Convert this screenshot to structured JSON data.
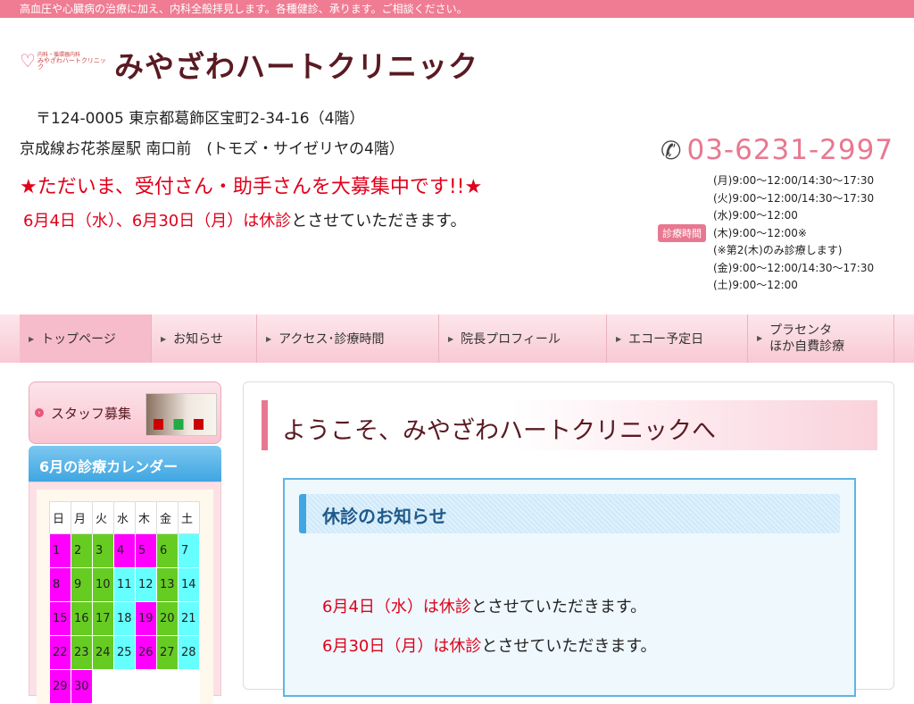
{
  "topbar": {
    "text": "高血圧や心臓病の治療に加え、内科全般拝見します。各種健診、承ります。ご相談ください。"
  },
  "header": {
    "logo_small": "内科・循環器内科",
    "logo_text": "みやざわハートクリニック",
    "site_name": "みやざわハートクリニック",
    "address": "〒124-0005 東京都葛飾区宝町2-34-16（4階）",
    "access": "京成線お花茶屋駅 南口前　(トモズ・サイゼリヤの4階）",
    "recruit": "★ただいま、受付さん・助手さんを大募集中です!!★",
    "closed_red": "6月4日（水）、6月30日（月）は休診",
    "closed_rest": "とさせていただきます。",
    "phone": "03-6231-2997",
    "hours_badge": "診療時間",
    "hours": [
      "(月)9:00〜12:00/14:30〜17:30",
      "(火)9:00〜12:00/14:30〜17:30",
      "(水)9:00〜12:00",
      "(木)9:00〜12:00※",
      "(※第2(木)のみ診療します)",
      "(金)9:00〜12:00/14:30〜17:30",
      "(土)9:00〜12:00"
    ]
  },
  "nav": {
    "items": [
      {
        "label": "トップページ"
      },
      {
        "label": "お知らせ"
      },
      {
        "label": "アクセス･診療時間"
      },
      {
        "label": "院長プロフィール"
      },
      {
        "label": "エコー予定日"
      },
      {
        "label1": "プラセンタ",
        "label2": "ほか自費診療"
      }
    ]
  },
  "sidebar": {
    "staff_label": "スタッフ募集",
    "calendar_title": "6月の診療カレンダー",
    "weekdays": [
      "日",
      "月",
      "火",
      "水",
      "木",
      "金",
      "土"
    ],
    "weeks": [
      [
        "1",
        "2",
        "3",
        "4",
        "5",
        "6",
        "7"
      ],
      [
        "8",
        "9",
        "10",
        "11",
        "12",
        "13",
        "14"
      ],
      [
        "15",
        "16",
        "17",
        "18",
        "19",
        "20",
        "21"
      ],
      [
        "22",
        "23",
        "24",
        "25",
        "26",
        "27",
        "28"
      ],
      [
        "29",
        "30",
        "",
        "",
        "",
        "",
        ""
      ]
    ]
  },
  "main": {
    "welcome": "ようこそ、みやざわハートクリニックへ",
    "notice_title": "休診のお知らせ",
    "notice1_red": "6月4日（水）は休診",
    "notice1_rest": "とさせていただきます。",
    "notice2_red": "6月30日（月）は休診",
    "notice2_rest": "とさせていただきます。"
  }
}
